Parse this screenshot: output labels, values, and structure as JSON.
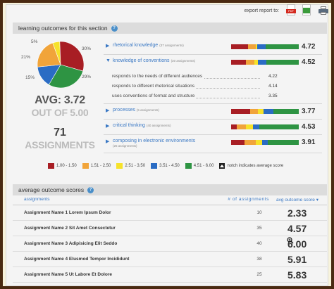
{
  "export": {
    "label": "export report to:",
    "options": [
      {
        "icon": "pdf-icon",
        "tag": "PDF"
      },
      {
        "icon": "excel-icon"
      },
      {
        "icon": "printer-icon"
      }
    ]
  },
  "colors": {
    "band1": "#a81e24",
    "band2": "#f1a43a",
    "band3": "#f6e22a",
    "band4": "#2a6cc4",
    "band5": "#2e9443",
    "accent": "#3a78c4"
  },
  "outcomes_section": {
    "title": "learning outcomes for this section",
    "pie_labels": [
      "5%",
      "30%",
      "21%",
      "15%",
      "29%"
    ],
    "pie_percents": [
      5,
      30,
      21,
      15,
      29
    ],
    "avg_label": "AVG: 3.72",
    "out_of": "OUT OF 5.00",
    "assignments_count": "71",
    "assignments_label": "ASSIGNMENTS",
    "outcomes": [
      {
        "name": "rhetorical knowledge",
        "count": "(37 assignments)",
        "score": "4.72",
        "expanded": false,
        "segments": [
          0.25,
          0.11,
          0.03,
          0.12,
          0.49
        ]
      },
      {
        "name": "knowledge of conventions",
        "count": "(30 assignments)",
        "score": "4.52",
        "expanded": true,
        "segments": [
          0.22,
          0.12,
          0.06,
          0.12,
          0.48
        ],
        "sub": [
          {
            "text": "responds to the needs of different audiences",
            "value": "4.22"
          },
          {
            "text": "responds to different rhetorical situations",
            "value": "4.14"
          },
          {
            "text": "uses conventions of format and structure",
            "value": "3.35"
          }
        ]
      },
      {
        "name": "processes",
        "count": "(5 assignments)",
        "score": "3.77",
        "expanded": false,
        "segments": [
          0.28,
          0.12,
          0.08,
          0.14,
          0.38
        ]
      },
      {
        "name": "critical thinking",
        "count": "(40 assignments)",
        "score": "4.53",
        "expanded": false,
        "segments": [
          0.08,
          0.14,
          0.1,
          0.1,
          0.58
        ]
      },
      {
        "name": "composing in electronic environments",
        "count": "(25 assignments)",
        "score": "3.91",
        "expanded": false,
        "segments": [
          0.2,
          0.16,
          0.1,
          0.08,
          0.46
        ]
      }
    ],
    "legend": [
      "1.00 - 1.50",
      "1.51 - 2.50",
      "2.51 - 3.50",
      "3.51 - 4.50",
      "4.51 - 6.00"
    ],
    "legend_notch": "notch indicates average score"
  },
  "avg_scores": {
    "title": "average outcome scores",
    "columns": {
      "name": "assignments",
      "count": "# of assignments",
      "score": "avg outcome score"
    },
    "rows": [
      {
        "name": "Assignment Name 1 Lorem Ipsum Dolor",
        "count": "10",
        "score": "2.33"
      },
      {
        "name": "Assignment Name 2 Sit Amet Consectetur",
        "count": "35",
        "score": "4.57"
      },
      {
        "name": "Assignment Name 3 Adipisicing Elit Seddo",
        "count": "40",
        "score": "6.00"
      },
      {
        "name": "Assignment Name 4 Elusmod Tempor Incididunt",
        "count": "38",
        "score": "5.91"
      },
      {
        "name": "Assignment Name 5 Ut Labore Et Dolore",
        "count": "25",
        "score": "5.83"
      }
    ]
  }
}
